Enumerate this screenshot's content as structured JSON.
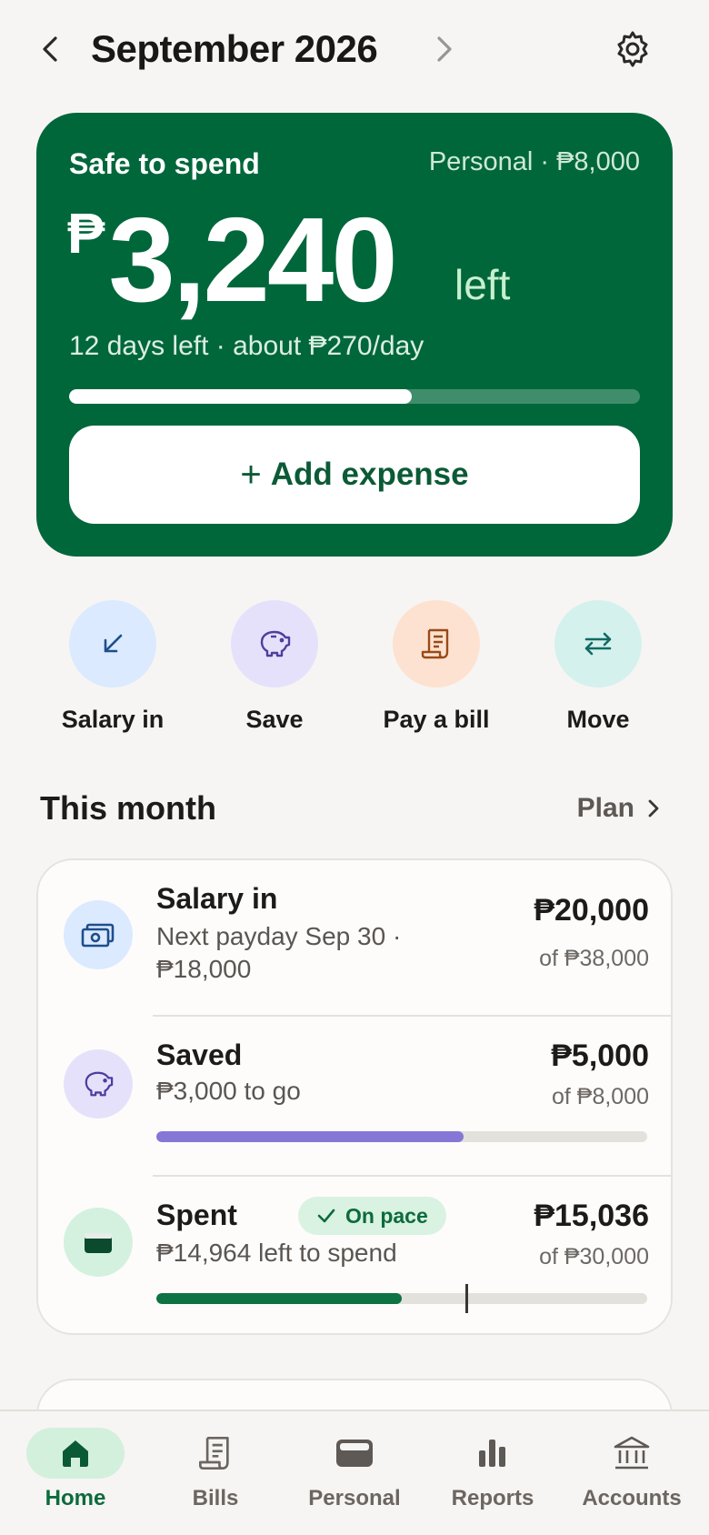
{
  "header": {
    "title": "September 2026",
    "prev_icon": "chevron-left-icon",
    "next_icon": "chevron-right-icon",
    "settings_icon": "gear-icon"
  },
  "hero": {
    "label": "Safe to spend",
    "context": "Personal · ₱8,000",
    "currency": "₱",
    "amount": "3,240",
    "suffix": "left",
    "days_info": "12 days left · about ₱270/day",
    "progress_fraction": 0.6,
    "add_button": "Add expense",
    "add_plus": "+"
  },
  "quick_actions": [
    {
      "label": "Salary in",
      "icon": "arrow-down-left-icon",
      "bg": "#dbeafe",
      "fg": "#1e4e8c"
    },
    {
      "label": "Save",
      "icon": "piggy-bank-icon",
      "bg": "#e6e1fb",
      "fg": "#4c3f9e"
    },
    {
      "label": "Pay a bill",
      "icon": "receipt-icon",
      "bg": "#fde2d1",
      "fg": "#9a4a16"
    },
    {
      "label": "Move",
      "icon": "transfer-arrows-icon",
      "bg": "#d4f1ee",
      "fg": "#116a62"
    }
  ],
  "section": {
    "title": "This month",
    "plan_label": "Plan"
  },
  "month": {
    "salary": {
      "title": "Salary in",
      "sub_line1": "Next payday Sep 30 ·",
      "sub_line2": "₱18,000",
      "amount": "₱20,000",
      "of": "of ₱38,000"
    },
    "saved": {
      "title": "Saved",
      "sub": "₱3,000 to go",
      "amount": "₱5,000",
      "of": "of ₱8,000",
      "progress_fraction": 0.625
    },
    "spent": {
      "title": "Spent",
      "badge": "On pace",
      "sub": "₱14,964 left to spend",
      "amount": "₱15,036",
      "of": "of ₱30,000",
      "progress_fraction": 0.5,
      "pace_fraction": 0.63
    }
  },
  "colors": {
    "brand_green": "#00673b",
    "saved_bar": "#8577d6",
    "spent_bar": "#0e7343"
  },
  "bottom_nav": [
    {
      "label": "Home",
      "icon": "home-icon",
      "active": true
    },
    {
      "label": "Bills",
      "icon": "receipt-icon",
      "active": false
    },
    {
      "label": "Personal",
      "icon": "wallet-icon",
      "active": false
    },
    {
      "label": "Reports",
      "icon": "bar-chart-icon",
      "active": false
    },
    {
      "label": "Accounts",
      "icon": "bank-icon",
      "active": false
    }
  ]
}
